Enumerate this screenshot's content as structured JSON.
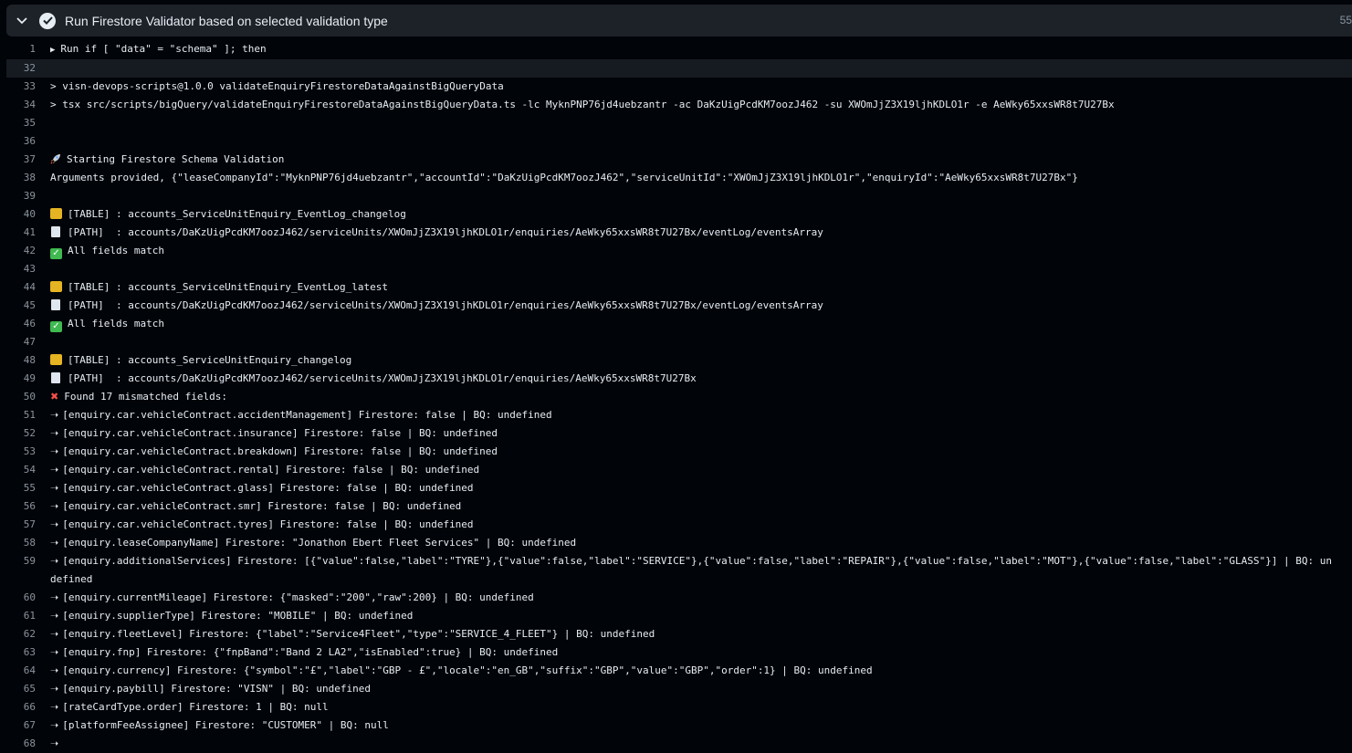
{
  "step": {
    "title": "Run Firestore Validator based on selected validation type",
    "duration": "55"
  },
  "log": [
    {
      "n": "1",
      "kind": "group",
      "text": "Run if [ \"data\" = \"schema\" ]; then"
    },
    {
      "n": "32",
      "kind": "blank",
      "text": "",
      "highlight": true
    },
    {
      "n": "33",
      "kind": "plain",
      "text": "> visn-devops-scripts@1.0.0 validateEnquiryFirestoreDataAgainstBigQueryData"
    },
    {
      "n": "34",
      "kind": "plain",
      "text": "> tsx src/scripts/bigQuery/validateEnquiryFirestoreDataAgainstBigQueryData.ts -lc MyknPNP76jd4uebzantr -ac DaKzUigPcdKM7oozJ462 -su XWOmJjZ3X19ljhKDLO1r -e AeWky65xxsWR8t7U27Bx"
    },
    {
      "n": "35",
      "kind": "blank",
      "text": ""
    },
    {
      "n": "36",
      "kind": "blank",
      "text": ""
    },
    {
      "n": "37",
      "kind": "rocket",
      "text": "Starting Firestore Schema Validation"
    },
    {
      "n": "38",
      "kind": "plain",
      "text": "Arguments provided, {\"leaseCompanyId\":\"MyknPNP76jd4uebzantr\",\"accountId\":\"DaKzUigPcdKM7oozJ462\",\"serviceUnitId\":\"XWOmJjZ3X19ljhKDLO1r\",\"enquiryId\":\"AeWky65xxsWR8t7U27Bx\"}"
    },
    {
      "n": "39",
      "kind": "blank",
      "text": ""
    },
    {
      "n": "40",
      "kind": "folder",
      "text": "[TABLE] : accounts_ServiceUnitEnquiry_EventLog_changelog"
    },
    {
      "n": "41",
      "kind": "doc",
      "text": "[PATH]  : accounts/DaKzUigPcdKM7oozJ462/serviceUnits/XWOmJjZ3X19ljhKDLO1r/enquiries/AeWky65xxsWR8t7U27Bx/eventLog/eventsArray"
    },
    {
      "n": "42",
      "kind": "ok",
      "text": "All fields match"
    },
    {
      "n": "43",
      "kind": "blank",
      "text": ""
    },
    {
      "n": "44",
      "kind": "folder",
      "text": "[TABLE] : accounts_ServiceUnitEnquiry_EventLog_latest"
    },
    {
      "n": "45",
      "kind": "doc",
      "text": "[PATH]  : accounts/DaKzUigPcdKM7oozJ462/serviceUnits/XWOmJjZ3X19ljhKDLO1r/enquiries/AeWky65xxsWR8t7U27Bx/eventLog/eventsArray"
    },
    {
      "n": "46",
      "kind": "ok",
      "text": "All fields match"
    },
    {
      "n": "47",
      "kind": "blank",
      "text": ""
    },
    {
      "n": "48",
      "kind": "folder",
      "text": "[TABLE] : accounts_ServiceUnitEnquiry_changelog"
    },
    {
      "n": "49",
      "kind": "doc",
      "text": "[PATH]  : accounts/DaKzUigPcdKM7oozJ462/serviceUnits/XWOmJjZ3X19ljhKDLO1r/enquiries/AeWky65xxsWR8t7U27Bx"
    },
    {
      "n": "50",
      "kind": "error",
      "text": "Found 17 mismatched fields:"
    },
    {
      "n": "51",
      "kind": "arrow",
      "text": "[enquiry.car.vehicleContract.accidentManagement] Firestore: false | BQ: undefined"
    },
    {
      "n": "52",
      "kind": "arrow",
      "text": "[enquiry.car.vehicleContract.insurance] Firestore: false | BQ: undefined"
    },
    {
      "n": "53",
      "kind": "arrow",
      "text": "[enquiry.car.vehicleContract.breakdown] Firestore: false | BQ: undefined"
    },
    {
      "n": "54",
      "kind": "arrow",
      "text": "[enquiry.car.vehicleContract.rental] Firestore: false | BQ: undefined"
    },
    {
      "n": "55",
      "kind": "arrow",
      "text": "[enquiry.car.vehicleContract.glass] Firestore: false | BQ: undefined"
    },
    {
      "n": "56",
      "kind": "arrow",
      "text": "[enquiry.car.vehicleContract.smr] Firestore: false | BQ: undefined"
    },
    {
      "n": "57",
      "kind": "arrow",
      "text": "[enquiry.car.vehicleContract.tyres] Firestore: false | BQ: undefined"
    },
    {
      "n": "58",
      "kind": "arrow",
      "text": "[enquiry.leaseCompanyName] Firestore: \"Jonathon Ebert Fleet Services\" | BQ: undefined"
    },
    {
      "n": "59",
      "kind": "arrow",
      "text": "[enquiry.additionalServices] Firestore: [{\"value\":false,\"label\":\"TYRE\"},{\"value\":false,\"label\":\"SERVICE\"},{\"value\":false,\"label\":\"REPAIR\"},{\"value\":false,\"label\":\"MOT\"},{\"value\":false,\"label\":\"GLASS\"}] | BQ: undefined"
    },
    {
      "n": "60",
      "kind": "arrow",
      "text": "[enquiry.currentMileage] Firestore: {\"masked\":\"200\",\"raw\":200} | BQ: undefined"
    },
    {
      "n": "61",
      "kind": "arrow",
      "text": "[enquiry.supplierType] Firestore: \"MOBILE\" | BQ: undefined"
    },
    {
      "n": "62",
      "kind": "arrow",
      "text": "[enquiry.fleetLevel] Firestore: {\"label\":\"Service4Fleet\",\"type\":\"SERVICE_4_FLEET\"} | BQ: undefined"
    },
    {
      "n": "63",
      "kind": "arrow",
      "text": "[enquiry.fnp] Firestore: {\"fnpBand\":\"Band 2 LA2\",\"isEnabled\":true} | BQ: undefined"
    },
    {
      "n": "64",
      "kind": "arrow",
      "text": "[enquiry.currency] Firestore: {\"symbol\":\"£\",\"label\":\"GBP - £\",\"locale\":\"en_GB\",\"suffix\":\"GBP\",\"value\":\"GBP\",\"order\":1} | BQ: undefined"
    },
    {
      "n": "65",
      "kind": "arrow",
      "text": "[enquiry.paybill] Firestore: \"VISN\" | BQ: undefined"
    },
    {
      "n": "66",
      "kind": "arrow",
      "text": "[rateCardType.order] Firestore: 1 | BQ: null"
    },
    {
      "n": "67",
      "kind": "arrow",
      "text": "[platformFeeAssignee] Firestore: \"CUSTOMER\" | BQ: null"
    },
    {
      "n": "68",
      "kind": "arrow",
      "text": ""
    }
  ],
  "icons": {
    "chevron": "chevron-down-icon",
    "status": "check-circle-icon",
    "group": "triangle-right-icon",
    "rocket": "rocket-icon",
    "folder": "folder-icon",
    "doc": "page-icon",
    "ok": "check-box-icon",
    "error": "cross-mark-icon",
    "arrow": "right-arrow-icon"
  }
}
